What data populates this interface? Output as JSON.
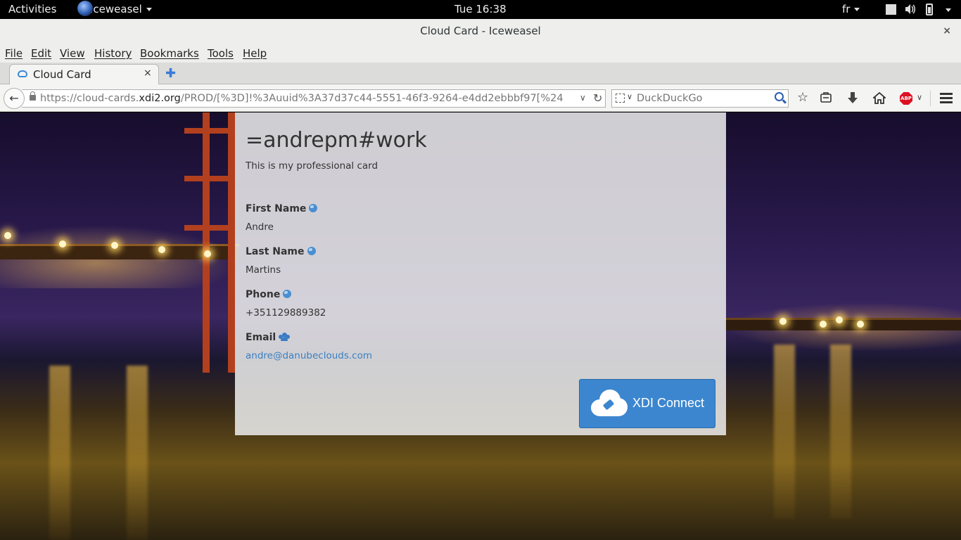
{
  "topbar": {
    "activities": "Activities",
    "app_name": "Iceweasel",
    "clock": "Tue 16:38",
    "keyboard_layout": "fr"
  },
  "window": {
    "title": "Cloud Card - Iceweasel",
    "close": "×"
  },
  "menubar": {
    "items": [
      "File",
      "Edit",
      "View",
      "History",
      "Bookmarks",
      "Tools",
      "Help"
    ]
  },
  "tabs": {
    "active_label": "Cloud Card",
    "close": "×",
    "new_tab": "✚"
  },
  "navbar": {
    "back": "←",
    "url_prefix": "https://cloud-cards.",
    "url_domain": "xdi2.org",
    "url_suffix": "/PROD/[%3D]!%3Auuid%3A37d37c44-5551-46f3-9264-e4dd2ebbbf97[%24",
    "search_placeholder": "DuckDuckGo",
    "abp_label": "ABP"
  },
  "card": {
    "title": "=andrepm#work",
    "description": "This is my professional card",
    "fields": [
      {
        "label": "First Name",
        "value": "Andre",
        "visibility_icon": "globe-icon"
      },
      {
        "label": "Last Name",
        "value": "Martins",
        "visibility_icon": "globe-icon"
      },
      {
        "label": "Phone",
        "value": "+351129889382",
        "visibility_icon": "globe-icon"
      },
      {
        "label": "Email",
        "value": "andre@danubeclouds.com",
        "visibility_icon": "group-icon"
      }
    ],
    "connect_button": "XDI Connect"
  },
  "colors": {
    "accent": "#3c86cf",
    "link": "#3a7fc1",
    "tower": "#b2401f"
  }
}
